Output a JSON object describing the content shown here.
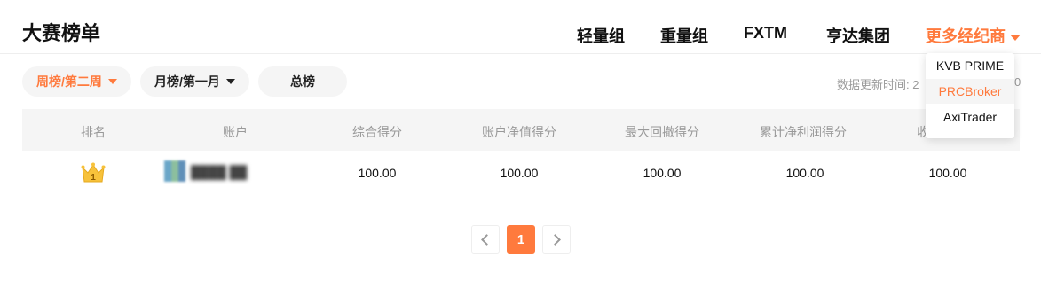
{
  "header": {
    "title": "大赛榜单",
    "nav": [
      "轻量组",
      "重量组",
      "FXTM",
      "亨达集团"
    ],
    "more_label": "更多经纪商"
  },
  "filters": {
    "weekly": "周榜/第二周",
    "monthly": "月榜/第一月",
    "total": "总榜"
  },
  "update_info": "数据更新时间: 2",
  "update_info_tail": "0",
  "table": {
    "headers": [
      "排名",
      "账户",
      "综合得分",
      "账户净值得分",
      "最大回撤得分",
      "累计净利润得分",
      "收"
    ],
    "rows": [
      {
        "rank": "1",
        "account": "████ ██",
        "scores": [
          "100.00",
          "100.00",
          "100.00",
          "100.00",
          "100.00"
        ]
      }
    ]
  },
  "pagination": {
    "current": "1"
  },
  "dropdown": {
    "items": [
      "KVB PRIME",
      "PRCBroker",
      "AxiTrader"
    ],
    "hovered_index": 1
  },
  "colors": {
    "accent": "#ff7a3d",
    "muted": "#999999",
    "panel": "#f5f5f5"
  },
  "icons": {
    "rank_first": "crown-icon",
    "prev": "chevron-left-icon",
    "next": "chevron-right-icon",
    "caret": "caret-down-icon"
  }
}
